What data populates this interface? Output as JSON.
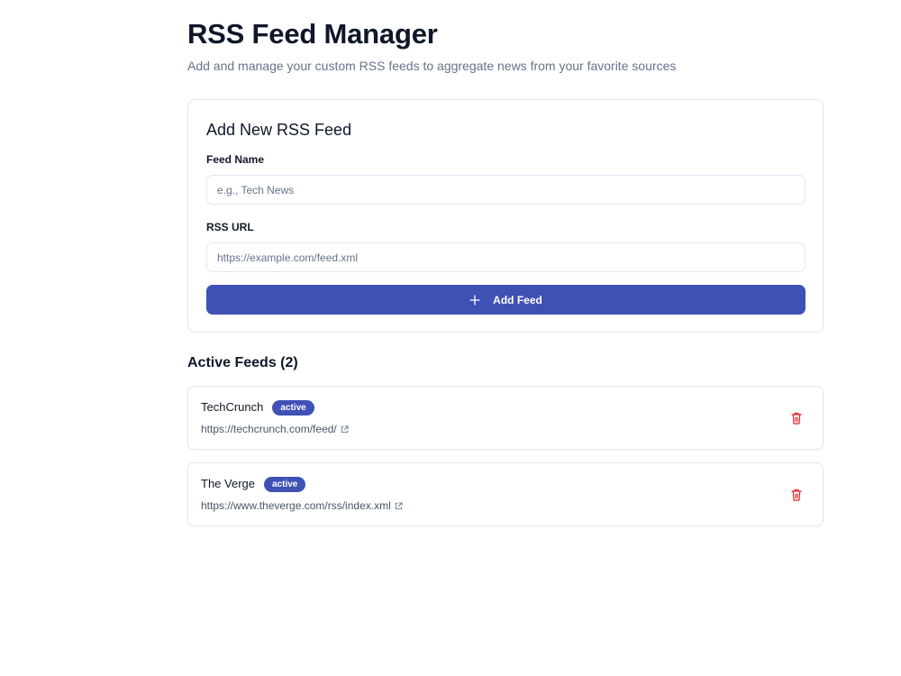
{
  "header": {
    "title": "RSS Feed Manager",
    "subtitle": "Add and manage your custom RSS feeds to aggregate news from your favorite sources"
  },
  "add_form": {
    "title": "Add New RSS Feed",
    "name_label": "Feed Name",
    "name_value": "",
    "name_placeholder": "e.g., Tech News",
    "url_label": "RSS URL",
    "url_value": "",
    "url_placeholder": "https://example.com/feed.xml",
    "submit_label": "Add Feed",
    "submit_icon": "plus-icon"
  },
  "feeds_section": {
    "title": "Active Feeds (2)"
  },
  "feeds": [
    {
      "name": "TechCrunch",
      "status": "active",
      "url": "https://techcrunch.com/feed/"
    },
    {
      "name": "The Verge",
      "status": "active",
      "url": "https://www.theverge.com/rss/index.xml"
    }
  ],
  "colors": {
    "primary": "#3f51b5",
    "danger": "#dc2626",
    "border": "#e2e8f0",
    "muted_text": "#64748b"
  }
}
